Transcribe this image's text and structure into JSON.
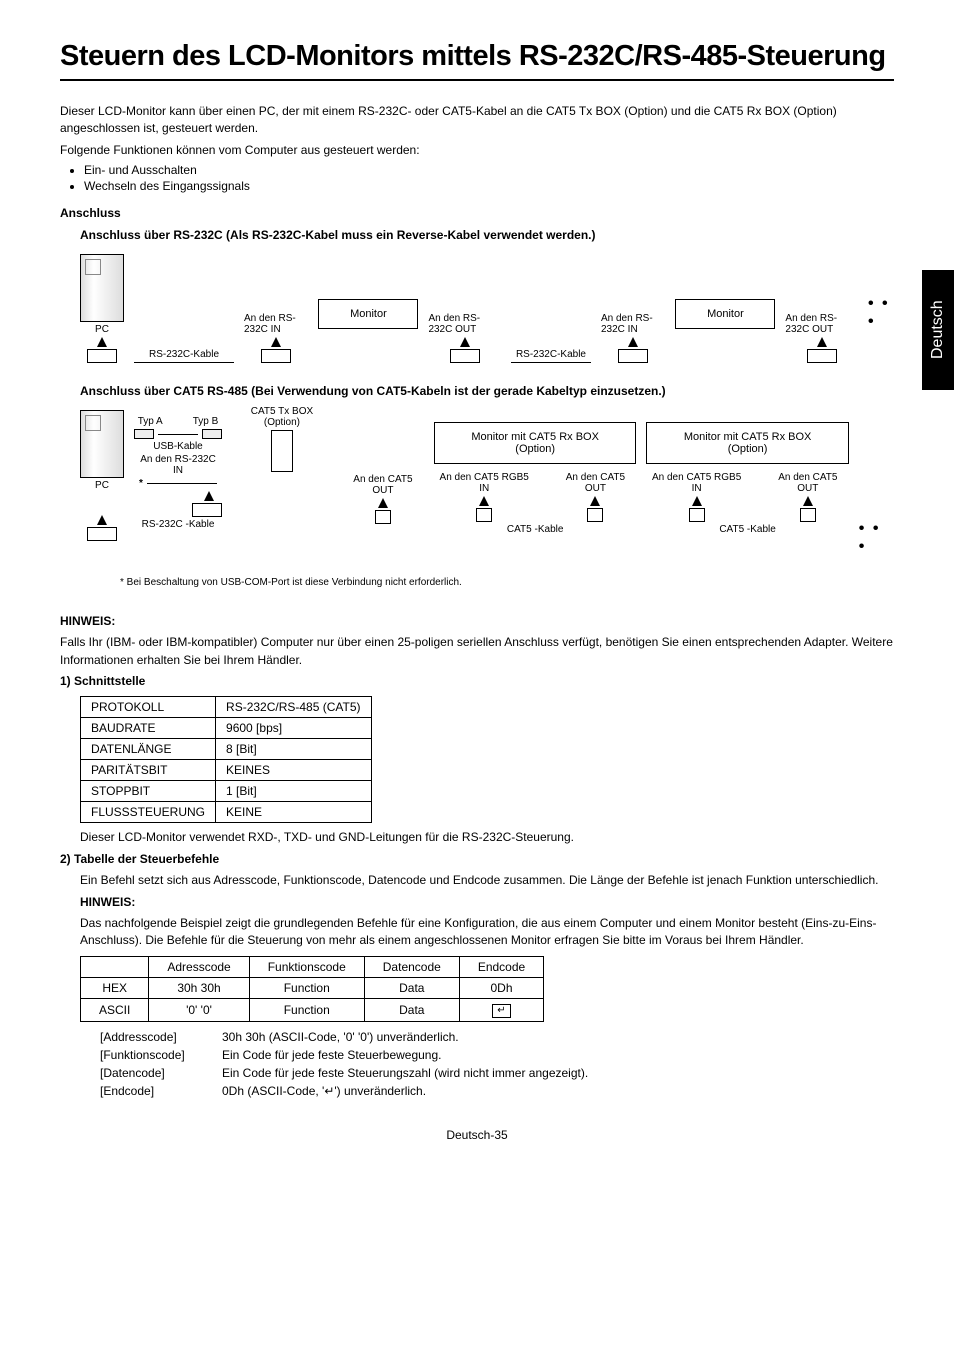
{
  "title": "Steuern des LCD-Monitors mittels RS-232C/RS-485-Steuerung",
  "side_tab": "Deutsch",
  "intro": {
    "p1": "Dieser LCD-Monitor kann über einen PC, der mit einem RS-232C- oder CAT5-Kabel an die CAT5 Tx BOX (Option) und die CAT5 Rx BOX (Option) angeschlossen ist, gesteuert werden.",
    "p2": "Folgende Funktionen können vom Computer aus gesteuert werden:",
    "bullets": [
      "Ein- und Ausschalten",
      "Wechseln des Eingangssignals"
    ]
  },
  "anschluss": {
    "heading": "Anschluss",
    "sub1": "Anschluss über RS-232C (Als RS-232C-Kabel muss ein Reverse-Kabel verwendet werden.)",
    "sub2": "Anschluss über CAT5 RS-485 (Bei Verwendung von CAT5-Kabeln ist der gerade Kabeltyp einzusetzen.)"
  },
  "diagram1": {
    "pc": "PC",
    "rs_cable": "RS-232C-Kable",
    "in": "An den RS-232C IN",
    "out": "An den RS-232C OUT",
    "monitor": "Monitor"
  },
  "diagram2": {
    "pc": "PC",
    "typ_a": "Typ A",
    "typ_b": "Typ B",
    "usb_cable": "USB-Kable",
    "txbox": "CAT5 Tx BOX (Option)",
    "rs_in": "An den RS-232C IN",
    "rs_cable": "RS-232C -Kable",
    "cat5_out": "An den CAT5 OUT",
    "cat5_rgb5_in": "An den CAT5 RGB5 IN",
    "cat5_cable": "CAT5 -Kable",
    "monitor_rx": "Monitor mit CAT5 Rx BOX (Option)",
    "star_note": "* Bei Beschaltung von USB-COM-Port ist diese Verbindung nicht erforderlich."
  },
  "hinweis": {
    "label": "HINWEIS:",
    "p1": "Falls Ihr (IBM- oder IBM-kompatibler) Computer nur über einen 25-poligen seriellen Anschluss verfügt, benötigen Sie einen entsprechenden Adapter. Weitere Informationen erhalten Sie bei Ihrem Händler."
  },
  "section1": {
    "heading": "1)  Schnittstelle",
    "rows": [
      [
        "PROTOKOLL",
        "RS-232C/RS-485 (CAT5)"
      ],
      [
        "BAUDRATE",
        "9600 [bps]"
      ],
      [
        "DATENLÄNGE",
        "8 [Bit]"
      ],
      [
        "PARITÄTSBIT",
        "KEINES"
      ],
      [
        "STOPPBIT",
        "1 [Bit]"
      ],
      [
        "FLUSSSTEUERUNG",
        "KEINE"
      ]
    ],
    "after": "Dieser LCD-Monitor verwendet RXD-, TXD- und GND-Leitungen für die RS-232C-Steuerung."
  },
  "section2": {
    "heading": "2)  Tabelle der Steuerbefehle",
    "p1": "Ein Befehl setzt sich aus Adresscode, Funktionscode, Datencode und Endcode zusammen. Die Länge der Befehle ist jenach Funktion unterschiedlich.",
    "hinweis_label": "HINWEIS:",
    "hinweis_body": "Das nachfolgende Beispiel zeigt die grundlegenden Befehle für eine Konfiguration, die aus einem Computer und einem Monitor besteht (Eins-zu-Eins-Anschluss). Die Befehle für die Steuerung von mehr als einem angeschlossenen Monitor erfragen Sie bitte im Voraus bei Ihrem Händler.",
    "table_headers": [
      "",
      "Adresscode",
      "Funktionscode",
      "Datencode",
      "Endcode"
    ],
    "table_rows": [
      [
        "HEX",
        "30h 30h",
        "Function",
        "Data",
        "0Dh"
      ],
      [
        "ASCII",
        "'0' '0'",
        "Function",
        "Data",
        "↵"
      ]
    ],
    "defs": [
      [
        "[Addresscode]",
        "30h 30h (ASCII-Code, '0' '0') unveränderlich."
      ],
      [
        "[Funktionscode]",
        "Ein Code für jede feste Steuerbewegung."
      ],
      [
        "[Datencode]",
        "Ein Code für jede feste Steuerungszahl (wird nicht immer angezeigt)."
      ],
      [
        "[Endcode]",
        "0Dh (ASCII-Code, '↵') unveränderlich."
      ]
    ]
  },
  "footer": "Deutsch-35"
}
